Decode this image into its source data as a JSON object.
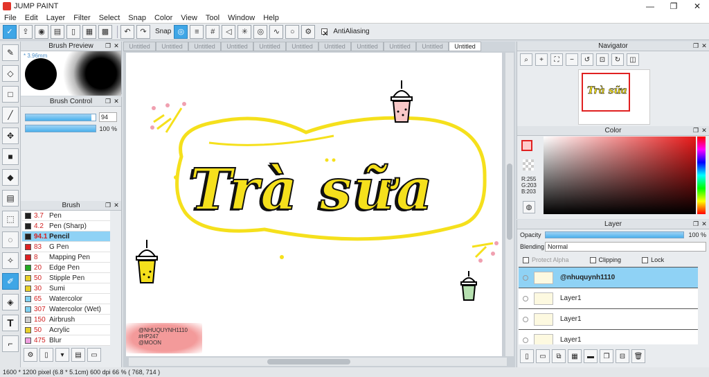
{
  "window": {
    "title": "JUMP PAINT",
    "minimize": "—",
    "maximize": "❐",
    "close": "✕"
  },
  "menu": [
    "File",
    "Edit",
    "Layer",
    "Filter",
    "Select",
    "Snap",
    "Color",
    "View",
    "Tool",
    "Window",
    "Help"
  ],
  "toolbar": {
    "snap_label": "Snap",
    "antialiasing_label": "AntiAliasing"
  },
  "panels": {
    "brush_preview": {
      "title": "Brush Preview",
      "size_label": "* 3.96mm"
    },
    "brush_control": {
      "title": "Brush Control",
      "size_value": "94",
      "opacity_value": "100 %"
    },
    "brush": {
      "title": "Brush"
    },
    "navigator": {
      "title": "Navigator"
    },
    "color": {
      "title": "Color",
      "r": "R:255",
      "g": "G:203",
      "b": "B:203"
    },
    "layer": {
      "title": "Layer",
      "opacity_label": "Opacity",
      "opacity_value": "100 %",
      "blending_label": "Blending",
      "blending_value": "Normal",
      "protect_alpha": "Protect Alpha",
      "clipping": "Clipping",
      "lock": "Lock"
    }
  },
  "brushes": [
    {
      "size": "3.7",
      "name": "Pen",
      "color": "#222222"
    },
    {
      "size": "4.2",
      "name": "Pen (Sharp)",
      "color": "#222222"
    },
    {
      "size": "94.1",
      "name": "Pencil",
      "color": "#222222"
    },
    {
      "size": "83",
      "name": "G Pen",
      "color": "#dd2222"
    },
    {
      "size": "8",
      "name": "Mapping Pen",
      "color": "#dd2222"
    },
    {
      "size": "20",
      "name": "Edge Pen",
      "color": "#22aa22"
    },
    {
      "size": "50",
      "name": "Stipple Pen",
      "color": "#e8d02a"
    },
    {
      "size": "30",
      "name": "Sumi",
      "color": "#e8d02a"
    },
    {
      "size": "65",
      "name": "Watercolor",
      "color": "#7fd0f0"
    },
    {
      "size": "307",
      "name": "Watercolor (Wet)",
      "color": "#7fd0f0"
    },
    {
      "size": "150",
      "name": "Airbrush",
      "color": "#cccccc"
    },
    {
      "size": "50",
      "name": "Acrylic",
      "color": "#e8d02a"
    },
    {
      "size": "475",
      "name": "Blur",
      "color": "#f0a0e0"
    }
  ],
  "tabs": [
    "Untitled",
    "Untitled",
    "Untitled",
    "Untitled",
    "Untitled",
    "Untitled",
    "Untitled",
    "Untitled",
    "Untitled",
    "Untitled",
    "Untitled"
  ],
  "canvas": {
    "main_text": "Trà sữa",
    "credit_lines": [
      "@NHUQUYNH1110",
      "#HP247",
      "@MOON"
    ],
    "yellow": "#f5e01c"
  },
  "layers": [
    {
      "name": "@nhuquynh1110"
    },
    {
      "name": "Layer1"
    },
    {
      "name": "Layer1"
    },
    {
      "name": "Layer1"
    }
  ],
  "status": "1600 * 1200 pixel   (6.8 * 5.1cm)  600 dpi  66 %  ( 768, 714 )"
}
